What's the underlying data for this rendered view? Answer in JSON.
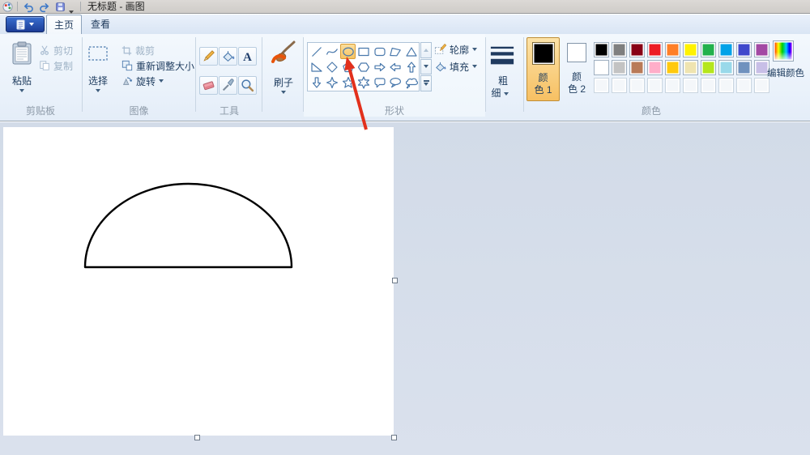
{
  "window": {
    "title": "无标题 - 画图"
  },
  "qat": {
    "icons": [
      "paint-app-icon",
      "undo-icon",
      "redo-icon",
      "save-icon",
      "qat-dropdown-icon"
    ]
  },
  "tabs": [
    {
      "label": "主页",
      "active": true
    },
    {
      "label": "查看",
      "active": false
    }
  ],
  "ribbon": {
    "clipboard": {
      "group": "剪贴板",
      "paste": "粘贴",
      "cut": "剪切",
      "copy": "复制"
    },
    "image": {
      "group": "图像",
      "select": "选择",
      "crop": "裁剪",
      "resize": "重新调整大小",
      "rotate": "旋转"
    },
    "tools": {
      "group": "工具",
      "items": [
        "pencil",
        "fill",
        "text",
        "eraser",
        "color-picker",
        "magnifier"
      ]
    },
    "brushes": {
      "label": "刷子"
    },
    "shapes": {
      "group": "形状",
      "outline": "轮廓",
      "fill": "填充",
      "selected": "ellipse",
      "items": [
        "line",
        "curve",
        "ellipse",
        "rectangle",
        "rounded-rectangle",
        "polygon",
        "triangle",
        "right-triangle",
        "diamond",
        "pentagon",
        "hexagon",
        "arrow-right",
        "arrow-left",
        "arrow-up",
        "arrow-down",
        "star-4",
        "star-5",
        "star-6",
        "callout-rounded",
        "callout-oval",
        "callout-cloud"
      ]
    },
    "size": {
      "line1": "粗",
      "line2": "细"
    },
    "colors": {
      "group": "颜色",
      "color1": {
        "line1": "颜",
        "line2": "色 1",
        "value": "#000000",
        "selected": true
      },
      "color2": {
        "line1": "颜",
        "line2": "色 2",
        "value": "#FFFFFF",
        "selected": false
      },
      "edit_colors": "编辑颜色",
      "palette_row1": [
        "#000000",
        "#7F7F7F",
        "#880015",
        "#ED1C24",
        "#FF7F27",
        "#FFF200",
        "#22B14C",
        "#00A2E8",
        "#3F48CC",
        "#A349A4"
      ],
      "palette_row2": [
        "#FFFFFF",
        "#C3C3C3",
        "#B97A57",
        "#FFAEC9",
        "#FFC90E",
        "#EFE4B0",
        "#B5E61D",
        "#99D9EA",
        "#7092BE",
        "#C8BFE7"
      ],
      "palette_row3_empty": 10
    }
  },
  "canvas": {
    "drawing": "black outlined semicircle"
  },
  "annotation": {
    "type": "red-arrow",
    "points_at": "ellipse-shape",
    "color": "#E2301C"
  },
  "accent": {
    "selection_fill": "#F7C063",
    "selection_border": "#D89C33"
  }
}
